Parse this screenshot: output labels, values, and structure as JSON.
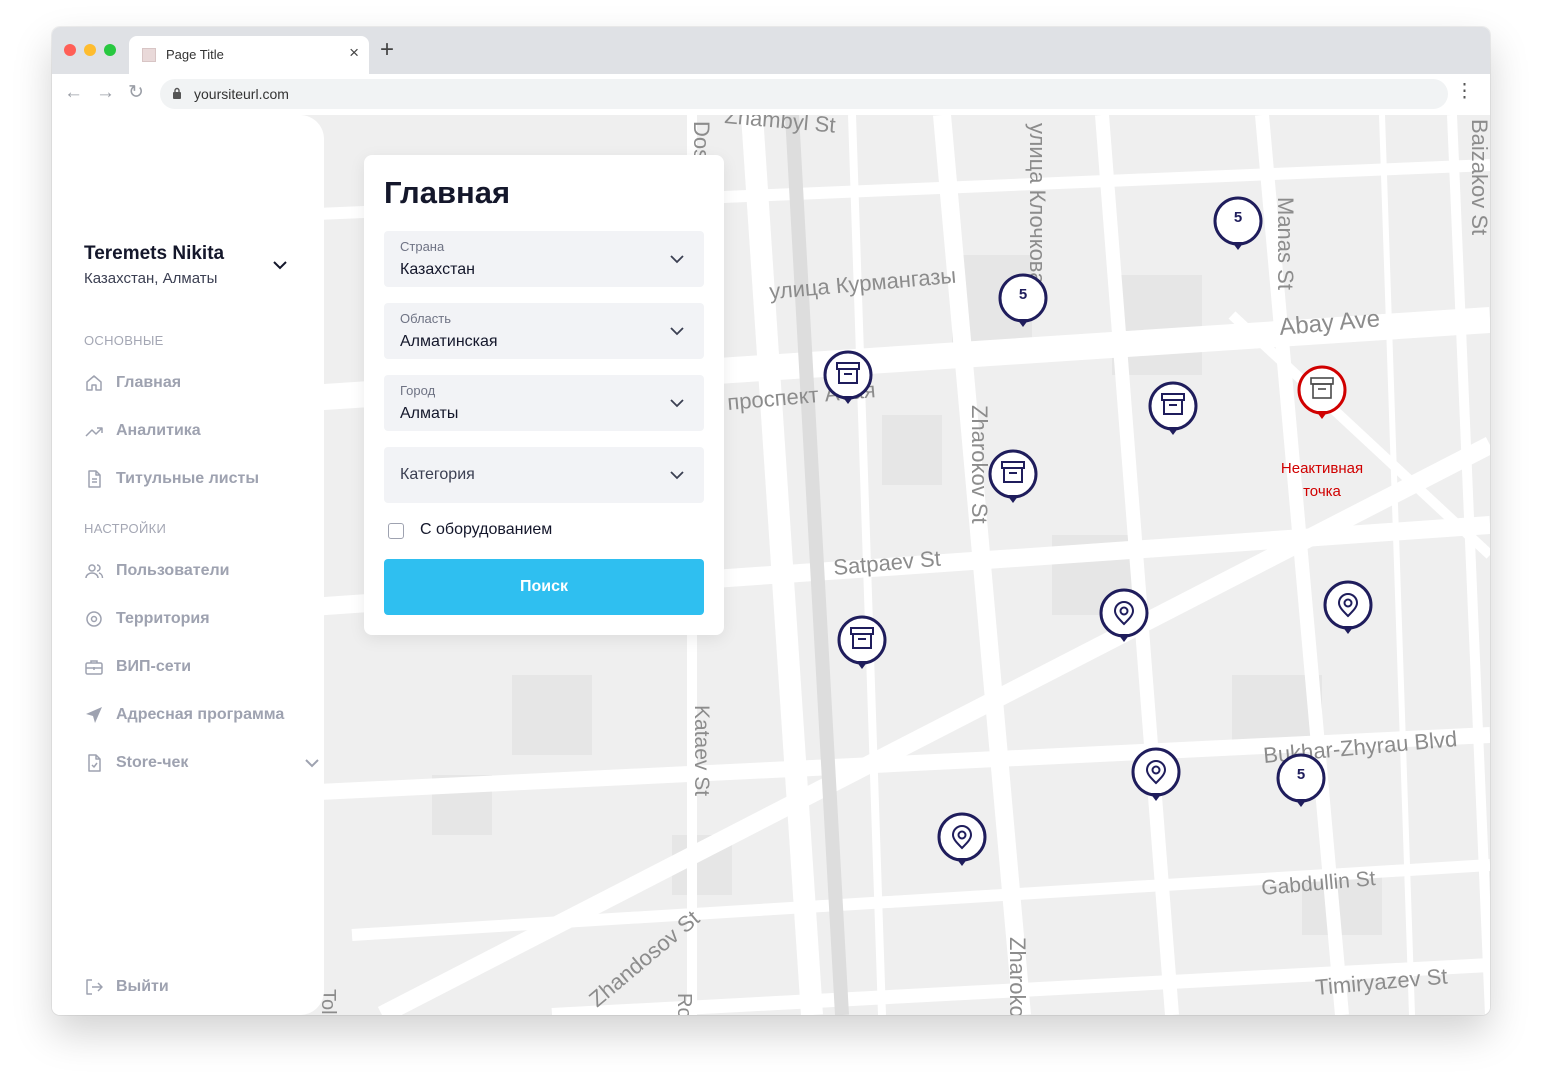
{
  "browser": {
    "tab_title": "Page Title",
    "new_tab": "+",
    "url": "yoursiteurl.com"
  },
  "user": {
    "name": "Teremets Nikita",
    "location": "Казахстан, Алматы"
  },
  "sidebar": {
    "section_main": "ОСНОВНЫЕ",
    "section_settings": "НАСТРОЙКИ",
    "items": [
      {
        "label": "Главная",
        "icon": "home-icon"
      },
      {
        "label": "Аналитика",
        "icon": "trend-icon"
      },
      {
        "label": "Титульные листы",
        "icon": "document-icon"
      },
      {
        "label": "Пользователи",
        "icon": "users-icon"
      },
      {
        "label": "Территория",
        "icon": "location-icon"
      },
      {
        "label": "ВИП-сети",
        "icon": "briefcase-icon"
      },
      {
        "label": "Адресная программа",
        "icon": "navigation-icon"
      },
      {
        "label": "Store-чек",
        "icon": "checklist-icon"
      }
    ],
    "logout": "Выйти"
  },
  "panel": {
    "title": "Главная",
    "country": {
      "label": "Страна",
      "value": "Казахстан"
    },
    "region": {
      "label": "Область",
      "value": "Алматинская"
    },
    "city": {
      "label": "Город",
      "value": "Алматы"
    },
    "category": {
      "placeholder": "Категория"
    },
    "equipment_checkbox": {
      "label": "С оборудованием",
      "checked": false
    },
    "search_button": "Поиск"
  },
  "map": {
    "street_labels": [
      "Zhambyl St",
      "Dostyk Ave",
      "улица Клочкова",
      "Baizakov St",
      "улица Курмангазы",
      "Manas St",
      "Abay Ave",
      "проспект Абая",
      "Zharokov St",
      "Satpaev St",
      "Bukhar-Zhyrau Blvd",
      "Kataev St",
      "Gabdullin St",
      "Zhandosov St",
      "Zharokov St",
      "Timiryazev St",
      "Tole Bi St",
      "Rozybakiev St"
    ],
    "clusters": [
      {
        "count": "5"
      },
      {
        "count": "5"
      },
      {
        "count": "5"
      }
    ],
    "inactive_point_label": "Неактивная точка",
    "colors": {
      "pin": "#1f1d5c",
      "inactive": "#d00000",
      "primary_button": "#2fbff0"
    }
  }
}
